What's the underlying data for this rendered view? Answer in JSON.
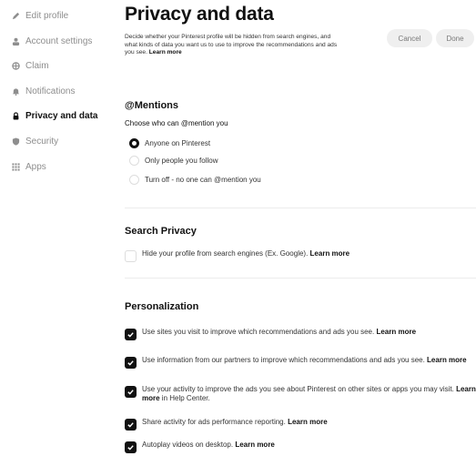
{
  "sidebar": {
    "items": [
      {
        "label": "Edit profile",
        "icon": "pencil-icon"
      },
      {
        "label": "Account settings",
        "icon": "person-icon"
      },
      {
        "label": "Claim",
        "icon": "globe-icon"
      },
      {
        "label": "Notifications",
        "icon": "bell-icon"
      },
      {
        "label": "Privacy and data",
        "icon": "lock-icon"
      },
      {
        "label": "Security",
        "icon": "shield-icon"
      },
      {
        "label": "Apps",
        "icon": "grid-icon"
      }
    ]
  },
  "header": {
    "title": "Privacy and data",
    "description": "Decide whether your Pinterest profile will be hidden from search engines, and what kinds of data you want us to use to improve the recommendations and ads you see.",
    "description_link": "Learn more",
    "cancel_label": "Cancel",
    "done_label": "Done"
  },
  "mentions": {
    "title": "@Mentions",
    "subtitle": "Choose who can @mention you",
    "options": [
      {
        "label": "Anyone on Pinterest",
        "selected": true
      },
      {
        "label": "Only people you follow",
        "selected": false
      },
      {
        "label": "Turn off - no one can @mention you",
        "selected": false
      }
    ]
  },
  "search_privacy": {
    "title": "Search Privacy",
    "option_label": "Hide your profile from search engines (Ex. Google).",
    "option_link": "Learn more",
    "checked": false
  },
  "personalization": {
    "title": "Personalization",
    "options": [
      {
        "pre": "Use sites you visit to improve which recommendations and ads you see.",
        "link": "Learn more",
        "post": "",
        "checked": true
      },
      {
        "pre": "Use information from our partners to improve which recommendations and ads you see.",
        "link": "Learn more",
        "post": "",
        "checked": true
      },
      {
        "pre": "Use your activity to improve the ads you see about Pinterest on other sites or apps you may visit.",
        "link": "Learn more",
        "post": "in Help Center.",
        "checked": true
      },
      {
        "pre": "Share activity for ads performance reporting.",
        "link": "Learn more",
        "post": "",
        "checked": true
      },
      {
        "pre": "Autoplay videos on desktop.",
        "link": "Learn more",
        "post": "",
        "checked": true
      }
    ]
  },
  "colors": {
    "text_primary": "#111111",
    "text_muted": "#8e8e8e",
    "button_bg": "#efefef",
    "checkbox_fill": "#111111"
  }
}
